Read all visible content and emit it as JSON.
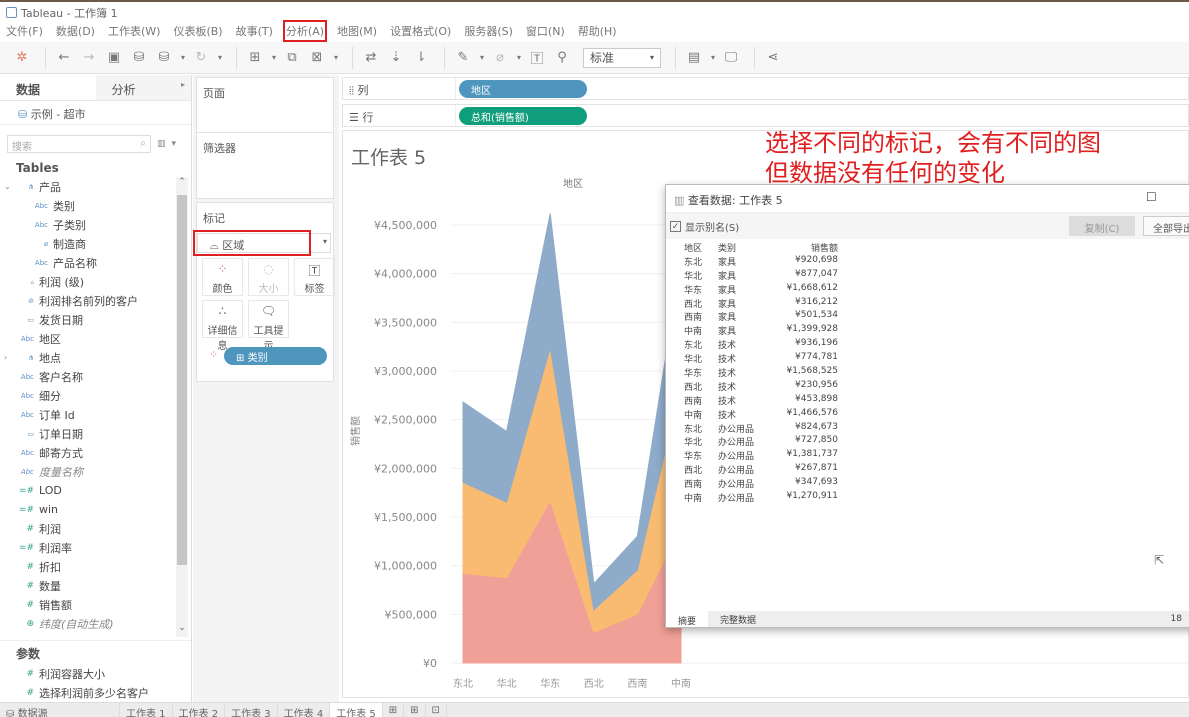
{
  "window": {
    "title": "Tableau - 工作簿 1"
  },
  "menu": [
    "文件(F)",
    "数据(D)",
    "工作表(W)",
    "仪表板(B)",
    "故事(T)",
    "分析(A)",
    "地图(M)",
    "设置格式(O)",
    "服务器(S)",
    "窗口(N)",
    "帮助(H)"
  ],
  "menu_highlighted_index": 5,
  "toolbar": {
    "fit_select": "标准",
    "icons": [
      "tableau-logo-icon",
      "back-icon",
      "forward-icon",
      "save-icon",
      "new-datasource-icon",
      "pause-update-icon",
      "refresh-icon",
      "new-sheet-icon",
      "duplicate-sheet-icon",
      "clear-sheet-icon",
      "swap-icon",
      "sort-asc-icon",
      "sort-desc-icon",
      "highlight-icon",
      "group-icon",
      "label-icon",
      "pin-icon",
      "show-cards-icon",
      "presentation-icon",
      "share-icon"
    ]
  },
  "left_panel": {
    "tabs": [
      "数据",
      "分析"
    ],
    "datasource": "示例 - 超市",
    "search_placeholder": "搜索",
    "tables_heading": "Tables",
    "fields": [
      {
        "label": "产品",
        "type": "hierarchy",
        "level": 0,
        "expanded": true
      },
      {
        "label": "类别",
        "type": "dim",
        "level": 1
      },
      {
        "label": "子类别",
        "type": "dim",
        "level": 1
      },
      {
        "label": "制造商",
        "type": "group",
        "level": 1
      },
      {
        "label": "产品名称",
        "type": "dim",
        "level": 1
      },
      {
        "label": "利润 (级)",
        "type": "bin",
        "level": 0
      },
      {
        "label": "利润排名前列的客户",
        "type": "set",
        "level": 0
      },
      {
        "label": "发货日期",
        "type": "date",
        "level": 0
      },
      {
        "label": "地区",
        "type": "dim",
        "level": 0
      },
      {
        "label": "地点",
        "type": "hierarchy",
        "level": 0,
        "expanded": false
      },
      {
        "label": "客户名称",
        "type": "dim",
        "level": 0
      },
      {
        "label": "细分",
        "type": "dim",
        "level": 0
      },
      {
        "label": "订单 Id",
        "type": "dim",
        "level": 0
      },
      {
        "label": "订单日期",
        "type": "date",
        "level": 0
      },
      {
        "label": "邮寄方式",
        "type": "dim",
        "level": 0
      },
      {
        "label": "度量名称",
        "type": "dim",
        "level": 0,
        "italic": true
      },
      {
        "label": "LOD",
        "type": "measure-calc",
        "level": 0
      },
      {
        "label": "win",
        "type": "measure-calc",
        "level": 0
      },
      {
        "label": "利润",
        "type": "measure",
        "level": 0
      },
      {
        "label": "利润率",
        "type": "measure-calc",
        "level": 0
      },
      {
        "label": "折扣",
        "type": "measure",
        "level": 0
      },
      {
        "label": "数量",
        "type": "measure",
        "level": 0
      },
      {
        "label": "销售额",
        "type": "measure",
        "level": 0
      },
      {
        "label": "纬度(自动生成)",
        "type": "geo",
        "level": 0,
        "italic": true
      }
    ],
    "params_heading": "参数",
    "params": [
      "利润容器大小",
      "选择利润前多少名客户"
    ]
  },
  "cards": {
    "pages": "页面",
    "filters": "筛选器",
    "marks": "标记",
    "mark_type": "区域",
    "mark_buttons": [
      "颜色",
      "大小",
      "标签",
      "详细信息",
      "工具提示"
    ],
    "color_pill": "类别"
  },
  "shelves": {
    "columns_label": "列",
    "rows_label": "行",
    "columns_pill": "地区",
    "rows_pill": "总和(销售额)"
  },
  "sheet": {
    "title": "工作表 5"
  },
  "annotation": [
    "选择不同的标记，会有不同的图",
    "但数据没有任何的变化"
  ],
  "chart_data": {
    "type": "area",
    "stacked": true,
    "title": "",
    "header": "地区",
    "xlabel": "",
    "ylabel": "销售额",
    "categories": [
      "东北",
      "华北",
      "华东",
      "西北",
      "西南",
      "中南"
    ],
    "series": [
      {
        "name": "家具",
        "color": "#f1a097",
        "values": [
          920698,
          877047,
          1668612,
          316212,
          501534,
          1399928
        ]
      },
      {
        "name": "办公用品",
        "color": "#f9bb72",
        "values": [
          936196,
          774781,
          1568525,
          230956,
          453898,
          1466576
        ]
      },
      {
        "name": "技术",
        "color": "#8eabc9",
        "values": [
          824673,
          727850,
          1381737,
          267871,
          347693,
          1270911
        ]
      }
    ],
    "yticks": [
      "¥0",
      "¥500,000",
      "¥1,000,000",
      "¥1,500,000",
      "¥2,000,000",
      "¥2,500,000",
      "¥3,000,000",
      "¥3,500,000",
      "¥4,000,000",
      "¥4,500,000"
    ],
    "ylim": [
      0,
      4800000
    ],
    "grid": true
  },
  "dialog": {
    "title": "查看数据: 工作表 5",
    "show_alias_label": "显示别名(S)",
    "show_alias_checked": true,
    "copy_button": "复制(C)",
    "export_button": "全部导出",
    "columns": [
      "地区",
      "类别",
      "销售额"
    ],
    "rows": [
      [
        "东北",
        "家具",
        "¥920,698"
      ],
      [
        "华北",
        "家具",
        "¥877,047"
      ],
      [
        "华东",
        "家具",
        "¥1,668,612"
      ],
      [
        "西北",
        "家具",
        "¥316,212"
      ],
      [
        "西南",
        "家具",
        "¥501,534"
      ],
      [
        "中南",
        "家具",
        "¥1,399,928"
      ],
      [
        "东北",
        "技术",
        "¥936,196"
      ],
      [
        "华北",
        "技术",
        "¥774,781"
      ],
      [
        "华东",
        "技术",
        "¥1,568,525"
      ],
      [
        "西北",
        "技术",
        "¥230,956"
      ],
      [
        "西南",
        "技术",
        "¥453,898"
      ],
      [
        "中南",
        "技术",
        "¥1,466,576"
      ],
      [
        "东北",
        "办公用品",
        "¥824,673"
      ],
      [
        "华北",
        "办公用品",
        "¥727,850"
      ],
      [
        "华东",
        "办公用品",
        "¥1,381,737"
      ],
      [
        "西北",
        "办公用品",
        "¥267,871"
      ],
      [
        "西南",
        "办公用品",
        "¥347,693"
      ],
      [
        "中南",
        "办公用品",
        "¥1,270,911"
      ]
    ],
    "footer_tabs": [
      "摘要",
      "完整数据"
    ],
    "footer_count": "18"
  },
  "bottom_tabs": {
    "datasource": "数据源",
    "sheets": [
      "工作表 1",
      "工作表 2",
      "工作表 3",
      "工作表 4",
      "工作表 5"
    ],
    "active_index": 4
  }
}
